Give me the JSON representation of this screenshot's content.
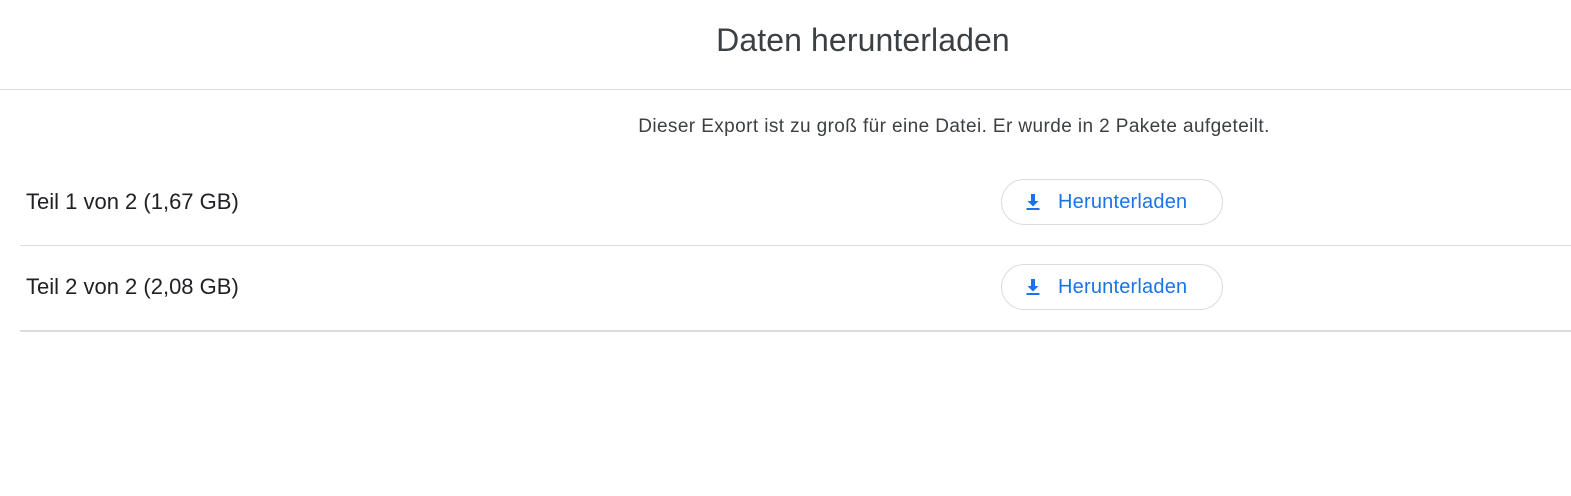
{
  "header": {
    "title": "Daten herunterladen"
  },
  "notice": {
    "text": "Dieser Export ist zu groß für eine Datei. Er wurde in 2 Pakete aufgeteilt."
  },
  "parts": [
    {
      "label": "Teil 1 von 2 (1,67 GB)",
      "button_label": "Herunterladen",
      "icon": "download-icon"
    },
    {
      "label": "Teil 2 von 2 (2,08 GB)",
      "button_label": "Herunterladen",
      "icon": "download-icon"
    }
  ],
  "colors": {
    "accent": "#1a73e8",
    "divider": "#dadce0",
    "text": "#202124"
  }
}
